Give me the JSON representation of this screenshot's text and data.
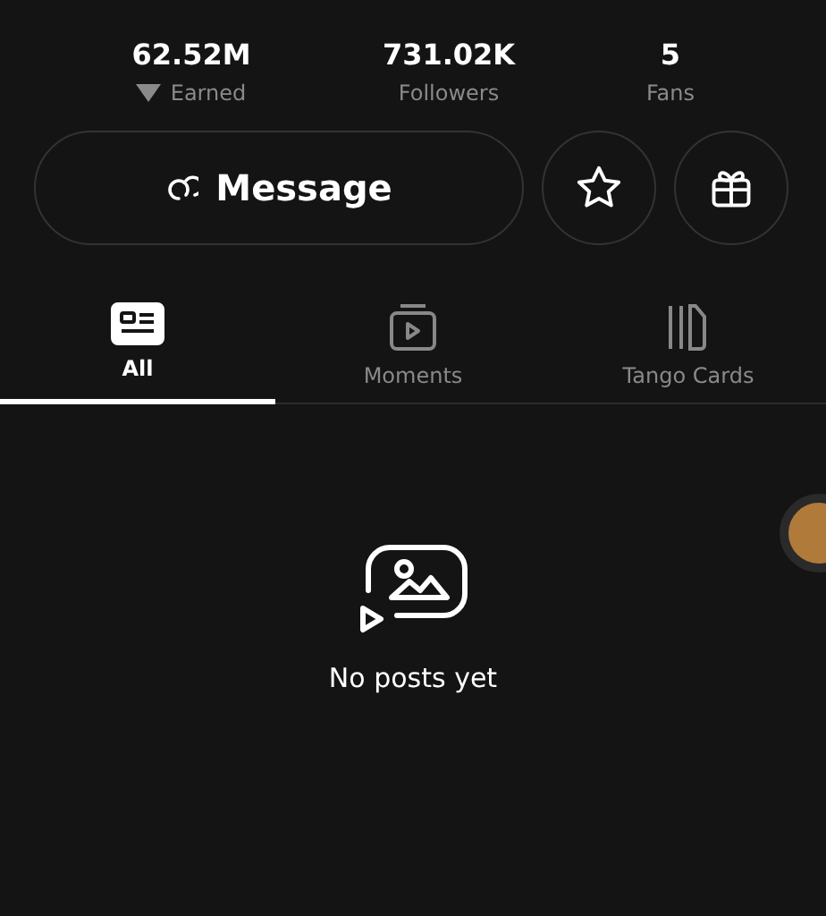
{
  "stats": [
    {
      "kind": "earned",
      "value": "62.52M",
      "label": "Earned"
    },
    {
      "kind": "plain",
      "value": "731.02K",
      "label": "Followers"
    },
    {
      "kind": "plain",
      "value": "5",
      "label": "Fans"
    }
  ],
  "message_button": {
    "label": "Message"
  },
  "tabs": [
    {
      "kind": "all",
      "label": "All",
      "selected": true
    },
    {
      "kind": "moments",
      "label": "Moments",
      "selected": false
    },
    {
      "kind": "cards",
      "label": "Tango Cards",
      "selected": false
    }
  ],
  "empty_state": {
    "text": "No posts yet"
  }
}
